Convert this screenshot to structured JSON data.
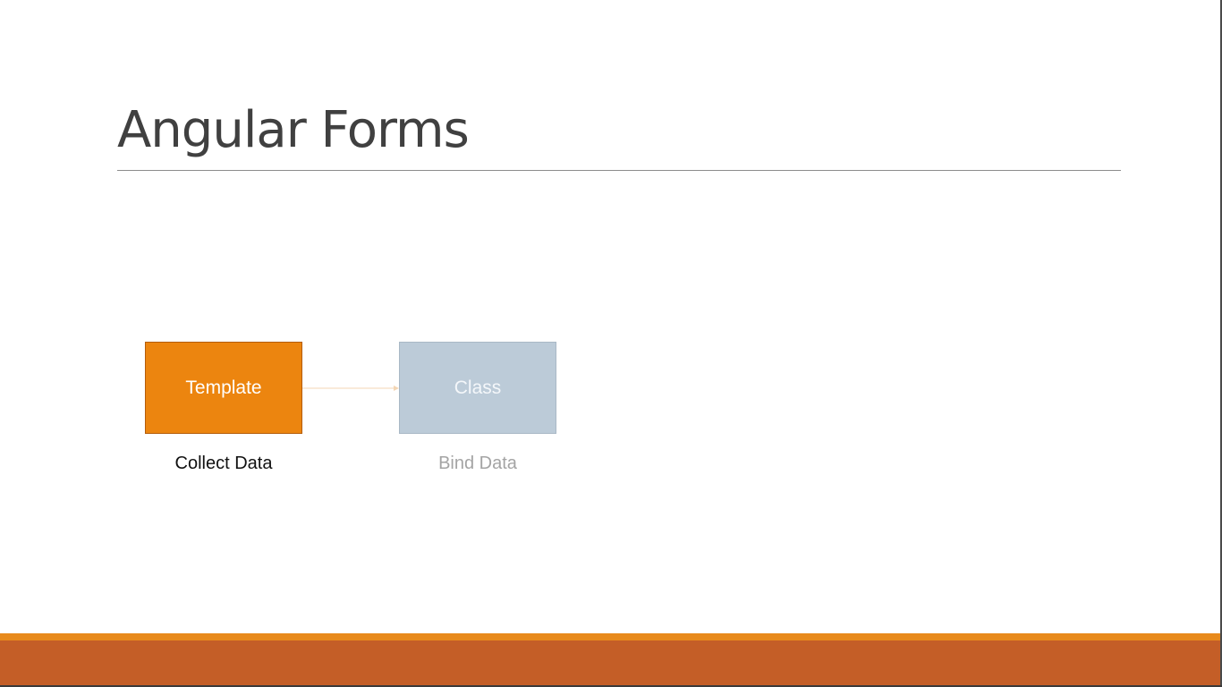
{
  "slide": {
    "title": "Angular Forms"
  },
  "diagram": {
    "nodes": [
      {
        "label": "Template",
        "caption": "Collect Data",
        "fill": "#ec850f"
      },
      {
        "label": "Class",
        "caption": "Bind Data",
        "fill": "#bccbd8"
      }
    ],
    "edge": {
      "from": "Template",
      "to": "Class",
      "color": "#f3d6b4"
    }
  },
  "theme": {
    "accent_orange": "#e88a1c",
    "accent_rust": "#c45e27",
    "title_color": "#404040"
  }
}
